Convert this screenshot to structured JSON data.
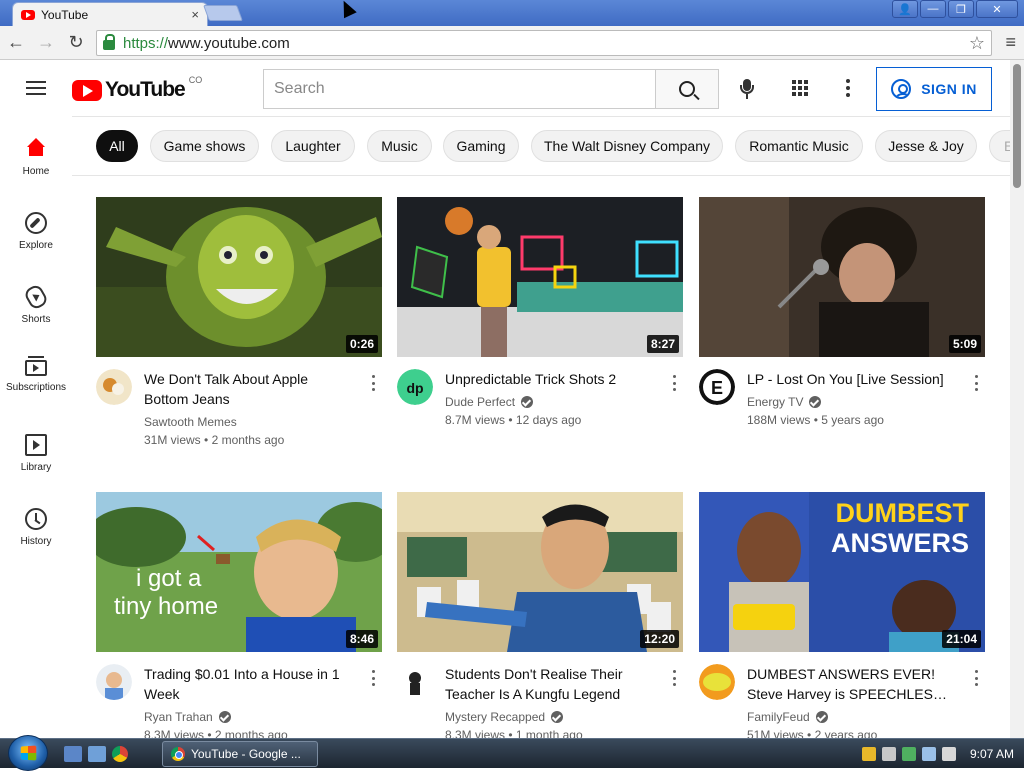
{
  "browser": {
    "tab_title": "YouTube",
    "tab_close": "×",
    "url_scheme": "https://",
    "url_rest": "www.youtube.com",
    "back": "←",
    "forward": "→",
    "reload": "↻",
    "star": "☆",
    "menu": "≡",
    "win_min": "—",
    "win_max": "❐",
    "win_close": "✕",
    "win_user": "👤"
  },
  "header": {
    "logo_text": "YouTube",
    "logo_region": "CO",
    "search_placeholder": "Search",
    "sign_in": "SIGN IN"
  },
  "sidebar": {
    "items": [
      {
        "label": "Home",
        "icon": "home-icon"
      },
      {
        "label": "Explore",
        "icon": "explore-icon"
      },
      {
        "label": "Shorts",
        "icon": "shorts-icon"
      },
      {
        "label": "Subscriptions",
        "icon": "subscriptions-icon"
      },
      {
        "label": "Library",
        "icon": "library-icon"
      },
      {
        "label": "History",
        "icon": "history-icon"
      }
    ]
  },
  "chips": [
    "All",
    "Game shows",
    "Laughter",
    "Music",
    "Gaming",
    "The Walt Disney Company",
    "Romantic Music",
    "Jesse & Joy",
    "E"
  ],
  "videos": [
    {
      "title": "We Don't Talk About Apple Bottom Jeans",
      "channel": "Sawtooth Memes",
      "verified": false,
      "views": "31M views",
      "age": "2 months ago",
      "duration": "0:26"
    },
    {
      "title": "Unpredictable Trick Shots 2",
      "channel": "Dude Perfect",
      "verified": true,
      "views": "8.7M views",
      "age": "12 days ago",
      "duration": "8:27"
    },
    {
      "title": "LP - Lost On You [Live Session]",
      "channel": "Energy TV",
      "verified": true,
      "views": "188M views",
      "age": "5 years ago",
      "duration": "5:09"
    },
    {
      "title": "Trading $0.01 Into a House in 1 Week",
      "channel": "Ryan Trahan",
      "verified": true,
      "views": "8.3M views",
      "age": "2 months ago",
      "duration": "8:46"
    },
    {
      "title": "Students Don't Realise Their Teacher Is A Kungfu Legend",
      "channel": "Mystery Recapped",
      "verified": true,
      "views": "8.3M views",
      "age": "1 month ago",
      "duration": "12:20"
    },
    {
      "title": "DUMBEST ANSWERS EVER! Steve Harvey is SPEECHLESS! | Family Feud",
      "channel": "FamilyFeud",
      "verified": true,
      "views": "51M views",
      "age": "2 years ago",
      "duration": "21:04"
    }
  ],
  "thumb_text": {
    "tiny_home_line1": "i got a",
    "tiny_home_line2": "tiny home",
    "feud_line1": "DUMBEST",
    "feud_line2": "ANSWERS"
  },
  "taskbar": {
    "task_label": "YouTube - Google ...",
    "clock": "9:07 AM"
  },
  "colors": {
    "brand_red": "#ff0000",
    "signin_blue": "#065fd4",
    "chip_active": "#0f0f0f"
  }
}
